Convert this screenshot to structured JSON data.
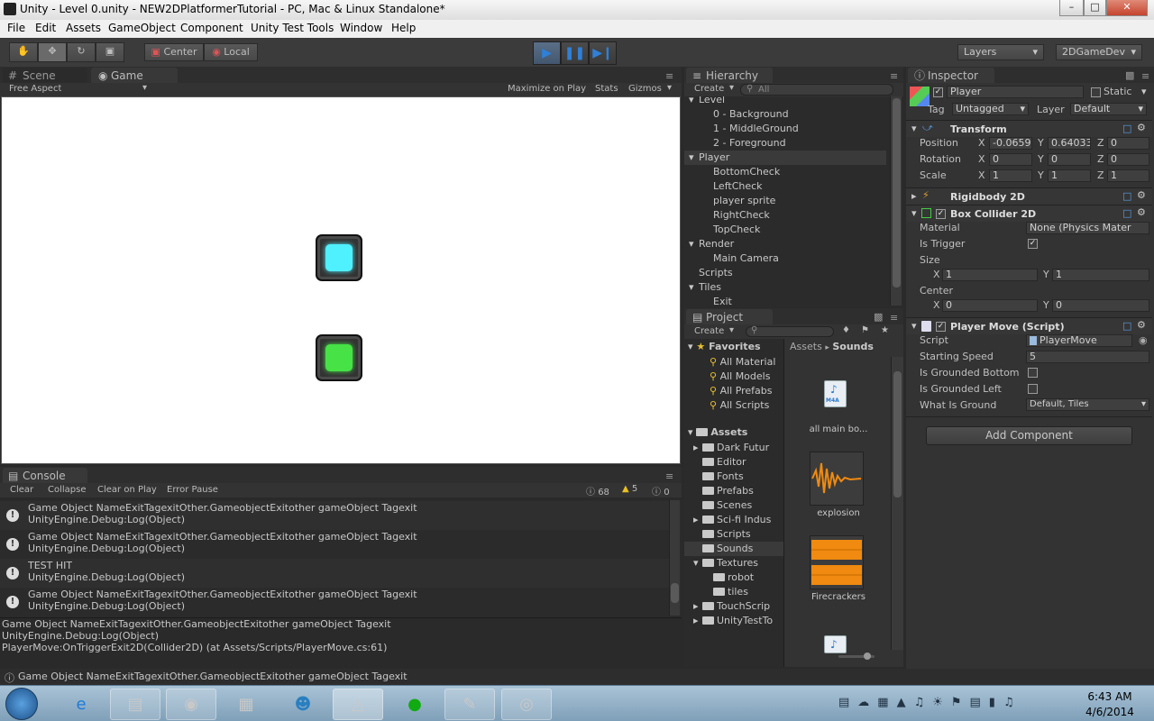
{
  "window": {
    "title": "Unity - Level 0.unity - NEW2DPlatformerTutorial - PC, Mac & Linux Standalone*",
    "minimize_icon": "minimize-icon",
    "maximize_icon": "maximize-icon",
    "close_icon": "close-icon"
  },
  "menu": [
    "File",
    "Edit",
    "Assets",
    "GameObject",
    "Component",
    "Unity Test Tools",
    "Window",
    "Help"
  ],
  "toolbar": {
    "pivot": "Center",
    "space": "Local",
    "layers": "Layers",
    "layout": "2DGameDev",
    "play_color": "#2f80d8"
  },
  "scene_tabs": {
    "scene": "Scene",
    "game": "Game"
  },
  "game_strip": {
    "aspect": "Free Aspect",
    "maximize": "Maximize on Play",
    "stats": "Stats",
    "gizmos": "Gizmos"
  },
  "game_objects": {
    "top_color": "#4ff0ff",
    "bottom_color": "#46e246"
  },
  "console": {
    "tab": "Console",
    "buttons": [
      "Clear",
      "Collapse",
      "Clear on Play",
      "Error Pause"
    ],
    "counts": {
      "info": "68",
      "warn": "5",
      "error": "0"
    },
    "rows": [
      {
        "l1": "Game Object NameExitTagexitOther.GameobjectExitother gameObject Tagexit",
        "l2": "UnityEngine.Debug:Log(Object)"
      },
      {
        "l1": "Game Object NameExitTagexitOther.GameobjectExitother gameObject Tagexit",
        "l2": "UnityEngine.Debug:Log(Object)"
      },
      {
        "l1": "TEST HIT",
        "l2": "UnityEngine.Debug:Log(Object)"
      },
      {
        "l1": "Game Object NameExitTagexitOther.GameobjectExitother gameObject Tagexit",
        "l2": "UnityEngine.Debug:Log(Object)"
      }
    ],
    "detail": [
      "Game Object NameExitTagexitOther.GameobjectExitother gameObject Tagexit",
      "UnityEngine.Debug:Log(Object)",
      "PlayerMove:OnTriggerExit2D(Collider2D) (at Assets/Scripts/PlayerMove.cs:61)"
    ]
  },
  "hierarchy": {
    "tab": "Hierarchy",
    "create": "Create",
    "search_placeholder": "All",
    "items": [
      {
        "label": "Level",
        "indent": 0
      },
      {
        "label": "0 - Background",
        "indent": 1
      },
      {
        "label": "1 - MiddleGround",
        "indent": 1
      },
      {
        "label": "2 - Foreground",
        "indent": 1
      },
      {
        "label": "Player",
        "indent": 0
      },
      {
        "label": "BottomCheck",
        "indent": 1
      },
      {
        "label": "LeftCheck",
        "indent": 1
      },
      {
        "label": "player sprite",
        "indent": 1
      },
      {
        "label": "RightCheck",
        "indent": 1
      },
      {
        "label": "TopCheck",
        "indent": 1
      },
      {
        "label": "Render",
        "indent": 0
      },
      {
        "label": "Main Camera",
        "indent": 1
      },
      {
        "label": "Scripts",
        "indent": 0
      },
      {
        "label": "Tiles",
        "indent": 0
      },
      {
        "label": "Exit",
        "indent": 1
      }
    ]
  },
  "project": {
    "tab": "Project",
    "create": "Create",
    "favorites_label": "Favorites",
    "favorites": [
      "All Material",
      "All Models",
      "All Prefabs",
      "All Scripts"
    ],
    "assets_label": "Assets",
    "folders": [
      {
        "label": "Dark Futur",
        "indent": 0
      },
      {
        "label": "Editor",
        "indent": 0
      },
      {
        "label": "Fonts",
        "indent": 0
      },
      {
        "label": "Prefabs",
        "indent": 0
      },
      {
        "label": "Scenes",
        "indent": 0
      },
      {
        "label": "Sci-fi Indus",
        "indent": 0
      },
      {
        "label": "Scripts",
        "indent": 0
      },
      {
        "label": "Sounds",
        "indent": 0
      },
      {
        "label": "Textures",
        "indent": 0
      },
      {
        "label": "robot",
        "indent": 1
      },
      {
        "label": "tiles",
        "indent": 1
      },
      {
        "label": "TouchScrip",
        "indent": 0
      },
      {
        "label": "UnityTestTo",
        "indent": 0
      }
    ],
    "breadcrumb": {
      "root": "Assets",
      "sep": "▸",
      "current": "Sounds"
    },
    "assets": [
      {
        "label": "all main bo...",
        "kind": "audio-file",
        "badge": "M4A"
      },
      {
        "label": "explosion",
        "kind": "waveform"
      },
      {
        "label": "Firecrackers",
        "kind": "waveform"
      }
    ]
  },
  "inspector": {
    "tab": "Inspector",
    "name": "Player",
    "static": "Static",
    "tag_label": "Tag",
    "tag": "Untagged",
    "layer_label": "Layer",
    "layer": "Default",
    "transform": {
      "title": "Transform",
      "position": {
        "label": "Position",
        "x": "-0.0659",
        "y": "0.64033",
        "z": "0"
      },
      "rotation": {
        "label": "Rotation",
        "x": "0",
        "y": "0",
        "z": "0"
      },
      "scale": {
        "label": "Scale",
        "x": "1",
        "y": "1",
        "z": "1"
      }
    },
    "rigidbody": {
      "title": "Rigidbody 2D"
    },
    "box_collider": {
      "title": "Box Collider 2D",
      "material_label": "Material",
      "material": "None (Physics Mater",
      "is_trigger_label": "Is Trigger",
      "size_label": "Size",
      "size_x": "1",
      "size_y": "1",
      "center_label": "Center",
      "center_x": "0",
      "center_y": "0"
    },
    "player_move": {
      "title": "Player Move (Script)",
      "script_label": "Script",
      "script": "PlayerMove",
      "speed_label": "Starting Speed",
      "speed": "5",
      "grounded_bottom_label": "Is Grounded Bottom",
      "grounded_left_label": "Is Grounded Left",
      "ground_label": "What Is Ground",
      "ground": "Default, Tiles"
    },
    "add_component": "Add Component",
    "axis": {
      "x": "X",
      "y": "Y",
      "z": "Z"
    }
  },
  "status": "Game Object NameExitTagexitOther.GameobjectExitother gameObject Tagexit",
  "taskbar": {
    "apps": [
      "windows-start-icon",
      "internet-explorer-icon",
      "file-explorer-icon",
      "chrome-icon",
      "app-icon",
      "messenger-icon",
      "unity-icon",
      "spotify-icon",
      "notepad-icon",
      "network-app-icon"
    ],
    "time": "6:43 AM",
    "date": "4/6/2014"
  }
}
